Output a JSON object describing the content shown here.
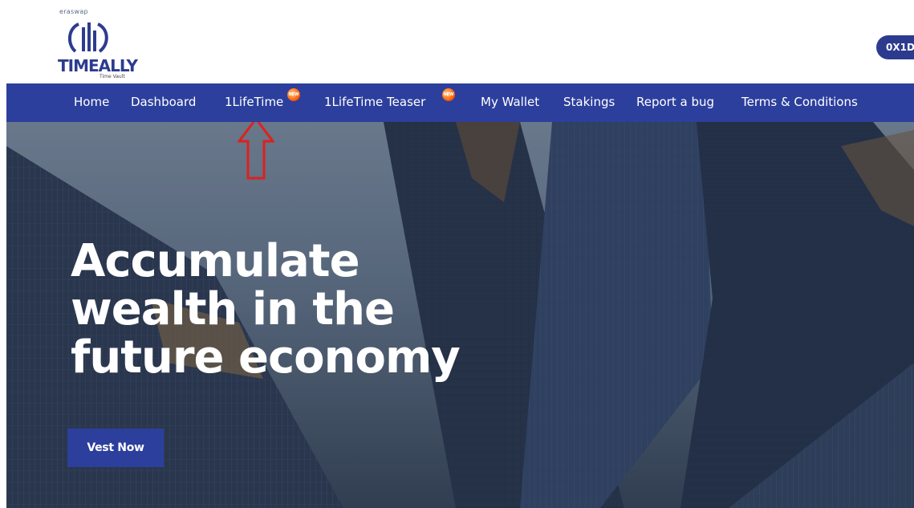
{
  "logo": {
    "tagline_small": "eraswap",
    "brand": "TIMEALLY",
    "subtitle": "Time Vault"
  },
  "wallet_button": {
    "label": "0X1D"
  },
  "nav": {
    "items": [
      {
        "label": "Home"
      },
      {
        "label": "Dashboard"
      },
      {
        "label": "1LifeTime",
        "badge": "NEW"
      },
      {
        "label": "1LifeTime Teaser",
        "badge": "NEW"
      },
      {
        "label": "My Wallet"
      },
      {
        "label": "Stakings"
      },
      {
        "label": "Report a bug"
      },
      {
        "label": "Terms & Conditions"
      }
    ]
  },
  "hero": {
    "headline_lines": [
      "Accumulate",
      "wealth in the",
      "future economy"
    ],
    "cta_label": "Vest Now"
  },
  "colors": {
    "brand_blue": "#2d3f9d",
    "badge_orange": "#ff5a00",
    "annotation_red": "#e0201b"
  }
}
